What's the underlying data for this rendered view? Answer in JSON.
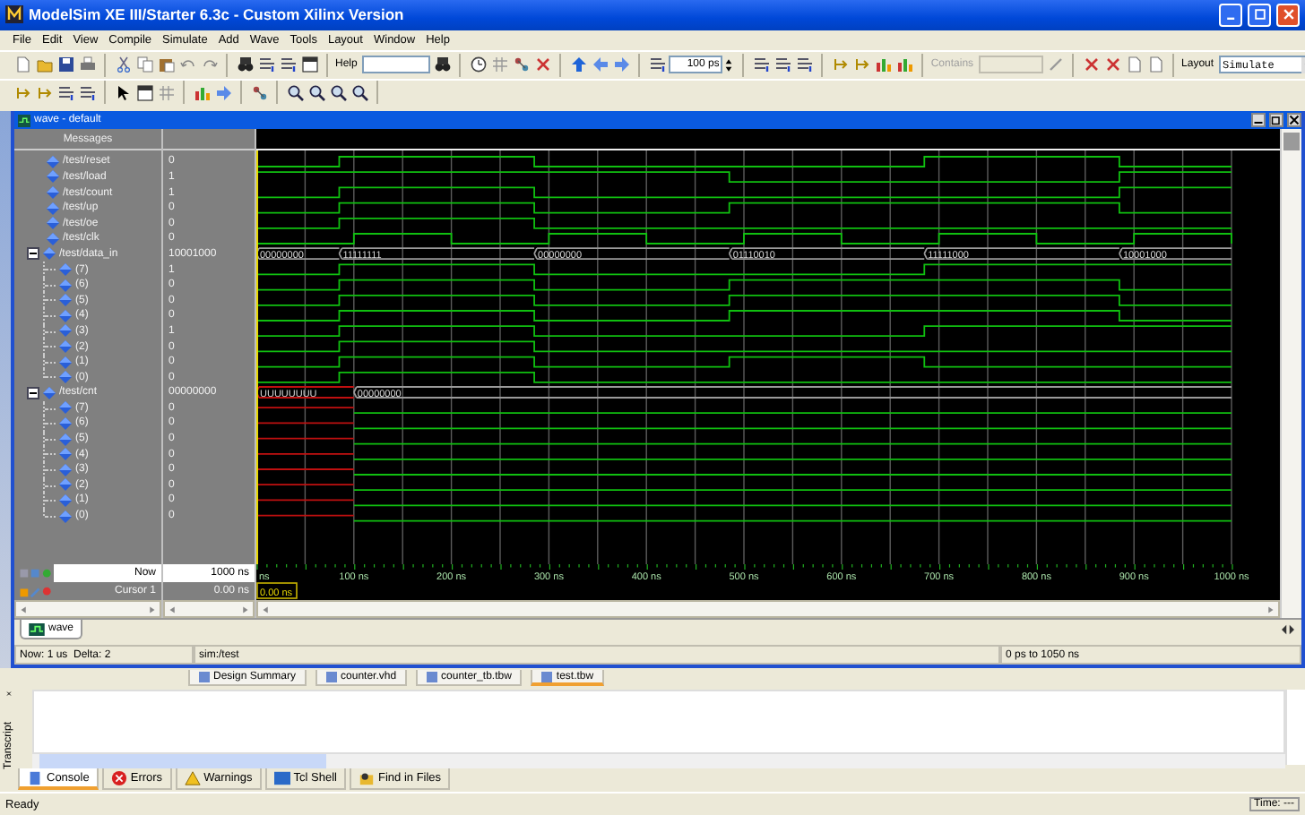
{
  "window": {
    "title": "ModelSim XE III/Starter 6.3c - Custom Xilinx Version"
  },
  "menu": [
    "File",
    "Edit",
    "View",
    "Compile",
    "Simulate",
    "Add",
    "Wave",
    "Tools",
    "Layout",
    "Window",
    "Help"
  ],
  "toolbar": {
    "help_label": "Help",
    "time_step": "100 ps",
    "contains_label": "Contains",
    "contains_disabled": true,
    "layout_label": "Layout",
    "layout_value": "Simulate"
  },
  "wave_window": {
    "title": "wave - default",
    "messages_header": "Messages",
    "signals": [
      {
        "name": "/test/reset",
        "value": "0"
      },
      {
        "name": "/test/load",
        "value": "1"
      },
      {
        "name": "/test/count",
        "value": "1"
      },
      {
        "name": "/test/up",
        "value": "0"
      },
      {
        "name": "/test/oe",
        "value": "0"
      },
      {
        "name": "/test/clk",
        "value": "0"
      },
      {
        "name": "/test/data_in",
        "value": "10001000",
        "expanded": true,
        "segments": [
          {
            "label": "00000000",
            "kind": "value"
          },
          {
            "label": "11111111",
            "kind": "value"
          },
          {
            "label": "00000000",
            "kind": "value"
          },
          {
            "label": "01110010",
            "kind": "value"
          },
          {
            "label": "11111000",
            "kind": "value"
          },
          {
            "label": "10001000",
            "kind": "value"
          }
        ],
        "children": [
          {
            "name": "(7)",
            "value": "1"
          },
          {
            "name": "(6)",
            "value": "0"
          },
          {
            "name": "(5)",
            "value": "0"
          },
          {
            "name": "(4)",
            "value": "0"
          },
          {
            "name": "(3)",
            "value": "1"
          },
          {
            "name": "(2)",
            "value": "0"
          },
          {
            "name": "(1)",
            "value": "0"
          },
          {
            "name": "(0)",
            "value": "0"
          }
        ]
      },
      {
        "name": "/test/cnt",
        "value": "00000000",
        "expanded": true,
        "segments": [
          {
            "label": "UUUUUUUU",
            "kind": "unknown"
          },
          {
            "label": "00000000",
            "kind": "value"
          }
        ],
        "children": [
          {
            "name": "(7)",
            "value": "0"
          },
          {
            "name": "(6)",
            "value": "0"
          },
          {
            "name": "(5)",
            "value": "0"
          },
          {
            "name": "(4)",
            "value": "0"
          },
          {
            "name": "(3)",
            "value": "0"
          },
          {
            "name": "(2)",
            "value": "0"
          },
          {
            "name": "(1)",
            "value": "0"
          },
          {
            "name": "(0)",
            "value": "0"
          }
        ]
      }
    ],
    "now": {
      "label": "Now",
      "value": "1000 ns"
    },
    "cursor": {
      "label": "Cursor 1",
      "value": "0.00 ns",
      "marker": "0.00 ns"
    },
    "timeline": [
      "ns",
      "100 ns",
      "200 ns",
      "300 ns",
      "400 ns",
      "500 ns",
      "600 ns",
      "700 ns",
      "800 ns",
      "900 ns",
      "1000 ns"
    ],
    "tabs": [
      {
        "label": "wave",
        "selected": true
      }
    ],
    "status": {
      "now_delta": "Now: 1 us  Delta: 2",
      "context": "sim:/test",
      "range": "0 ps to 1050 ns"
    }
  },
  "document_tabs": [
    {
      "label": "Design Summary",
      "selected": false
    },
    {
      "label": "counter.vhd",
      "selected": false
    },
    {
      "label": "counter_tb.tbw",
      "selected": false
    },
    {
      "label": "test.tbw",
      "selected": true
    }
  ],
  "transcript": {
    "label": "Transcript",
    "tabs": [
      {
        "label": "Console",
        "selected": true
      },
      {
        "label": "Errors",
        "selected": false
      },
      {
        "label": "Warnings",
        "selected": false
      },
      {
        "label": "Tcl Shell",
        "selected": false
      },
      {
        "label": "Find in Files",
        "selected": false
      }
    ]
  },
  "status_bar": {
    "message": "Ready",
    "time": "Time: ---"
  }
}
